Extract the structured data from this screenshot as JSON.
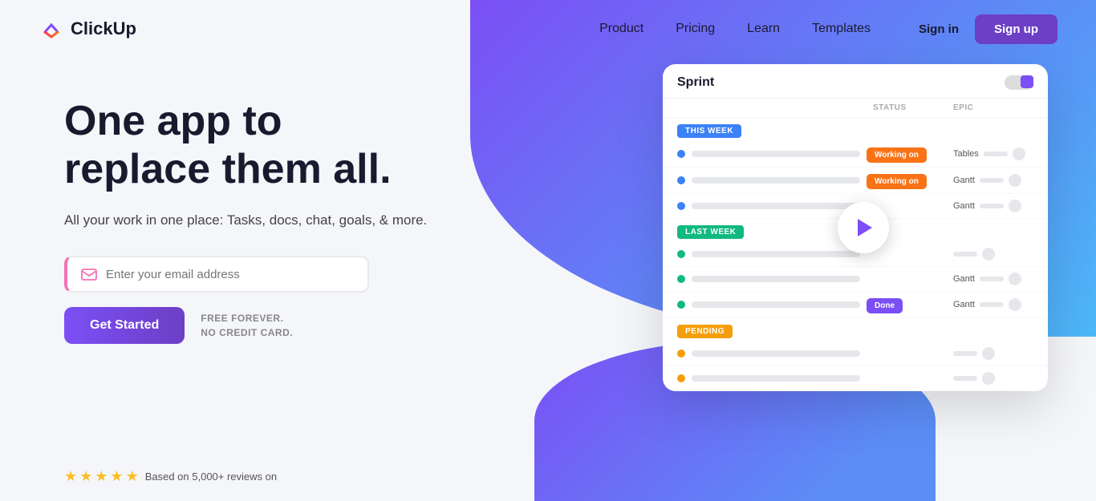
{
  "meta": {
    "title": "ClickUp - One app to replace them all"
  },
  "logo": {
    "text": "ClickUp"
  },
  "nav": {
    "links": [
      {
        "id": "product",
        "label": "Product"
      },
      {
        "id": "pricing",
        "label": "Pricing"
      },
      {
        "id": "learn",
        "label": "Learn"
      },
      {
        "id": "templates",
        "label": "Templates"
      }
    ],
    "signin": "Sign in",
    "signup": "Sign up"
  },
  "hero": {
    "title_line1": "One app to",
    "title_line2": "replace them all.",
    "subtitle": "All your work in one place: Tasks, docs, chat, goals, & more.",
    "email_placeholder": "Enter your email address",
    "cta_button": "Get Started",
    "free_line1": "FREE FOREVER.",
    "free_line2": "NO CREDIT CARD."
  },
  "reviews": {
    "text": "Based on 5,000+ reviews on"
  },
  "dashboard": {
    "title": "Sprint",
    "col_status": "STATUS",
    "col_epic": "EPIC",
    "sections": [
      {
        "badge": "THIS WEEK",
        "badge_class": "this-week",
        "rows": [
          {
            "dot": "blue",
            "status": "Working on",
            "epic": "Tables"
          },
          {
            "dot": "blue",
            "status": "Working on",
            "epic": "Gantt"
          },
          {
            "dot": "blue",
            "status": "",
            "epic": "Gantt"
          }
        ]
      },
      {
        "badge": "LAST WEEK",
        "badge_class": "last-week",
        "rows": [
          {
            "dot": "green",
            "status": "",
            "epic": ""
          },
          {
            "dot": "green",
            "status": "",
            "epic": "Gantt"
          },
          {
            "dot": "green",
            "status": "Done",
            "epic": "Gantt"
          }
        ]
      },
      {
        "badge": "PENDING",
        "badge_class": "pending",
        "rows": [
          {
            "dot": "yellow",
            "status": "",
            "epic": ""
          },
          {
            "dot": "yellow",
            "status": "",
            "epic": ""
          }
        ]
      }
    ]
  }
}
